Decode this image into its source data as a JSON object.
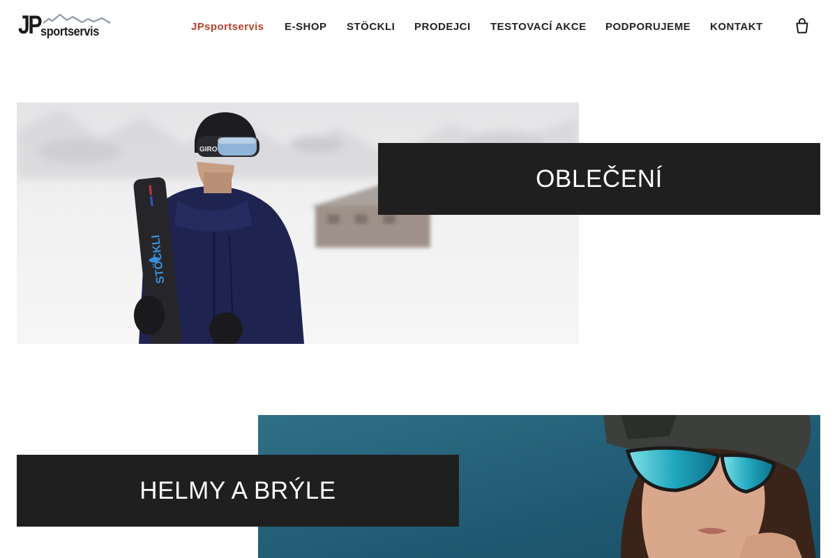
{
  "logo": {
    "jp": "JP",
    "rest": "sportservis"
  },
  "nav": {
    "items": [
      {
        "label": "JPsportservis",
        "active": true
      },
      {
        "label": "E-SHOP"
      },
      {
        "label": "STÖCKLI"
      },
      {
        "label": "PRODEJCI"
      },
      {
        "label": "TESTOVACÍ AKCE"
      },
      {
        "label": "PODPORUJEME"
      },
      {
        "label": "KONTAKT"
      }
    ],
    "active_color": "#b5412a"
  },
  "cart": {
    "icon": "shopping-bag-icon"
  },
  "sections": [
    {
      "title": "OBLEČENÍ",
      "image": "skier-with-stockli-skis-photo",
      "ski_brand": "STÖCKLI",
      "helmet_brand": "GIRO"
    },
    {
      "title": "HELMY A BRÝLE",
      "image": "woman-helmet-goggles-photo"
    }
  ],
  "colors": {
    "banner_bg": "#1f1f1f",
    "banner_text": "#ffffff",
    "text": "#222222"
  }
}
